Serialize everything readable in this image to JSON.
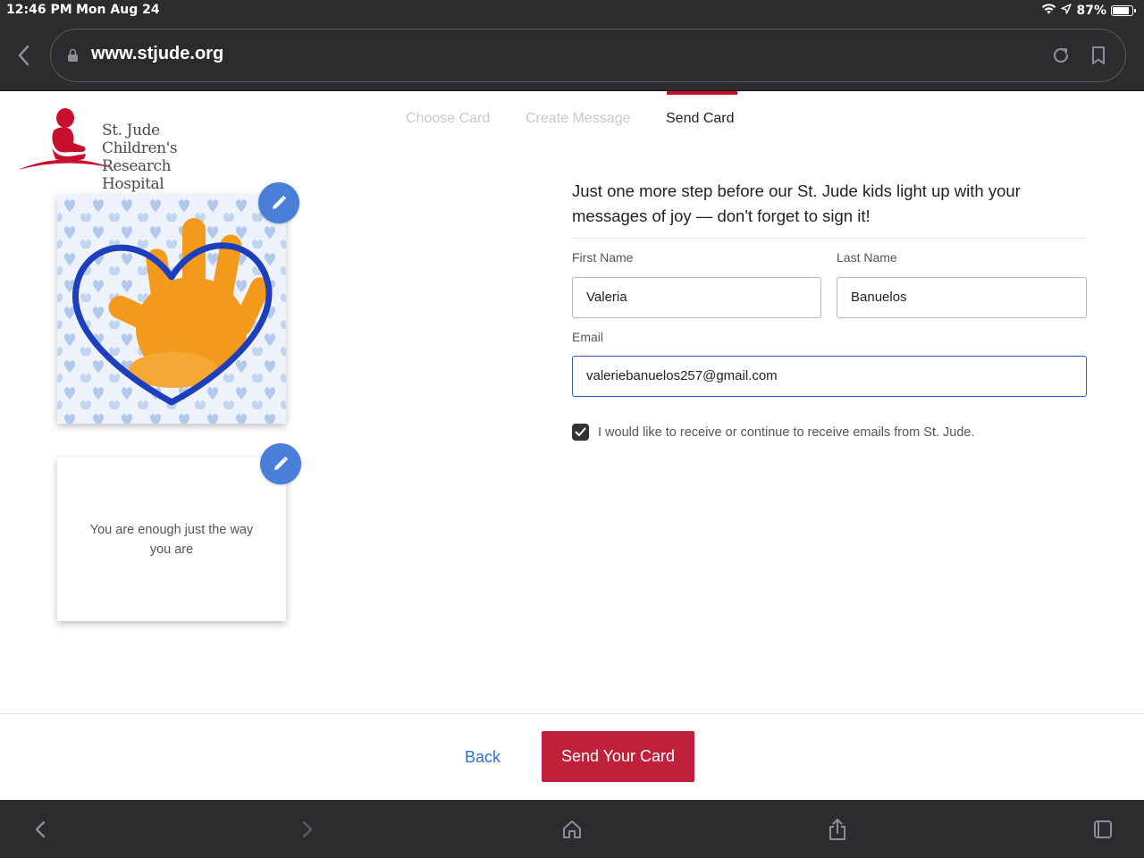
{
  "status_bar": {
    "time": "12:46 PM",
    "date": "Mon Aug 24",
    "battery": "87%",
    "battery_level": 0.87
  },
  "browser": {
    "url": "www.stjude.org"
  },
  "logo": {
    "line1": "St. Jude Children's",
    "line2": "Research Hospital",
    "color": "#c8102e"
  },
  "steps": [
    {
      "label": "Choose Card",
      "state": "completed"
    },
    {
      "label": "Create Message",
      "state": "completed"
    },
    {
      "label": "Send Card",
      "state": "active"
    }
  ],
  "card": {
    "message": "You are enough just the way you are"
  },
  "form": {
    "intro": "Just one more step before our St. Jude kids light up with your messages of joy — don't forget to sign it!",
    "first_name_label": "First Name",
    "first_name_value": "Valeria",
    "last_name_label": "Last Name",
    "last_name_value": "Banuelos",
    "email_label": "Email",
    "email_value": "valeriebanuelos257@gmail.com",
    "consent_checked": true,
    "consent_text": "I would like to receive or continue to receive emails from St. Jude."
  },
  "actions": {
    "back_label": "Back",
    "send_label": "Send Your Card"
  },
  "colors": {
    "accent": "#c1203a",
    "link": "#2f6fd6",
    "edit_button": "#4a7fd9",
    "chrome": "#2c2c2e"
  }
}
